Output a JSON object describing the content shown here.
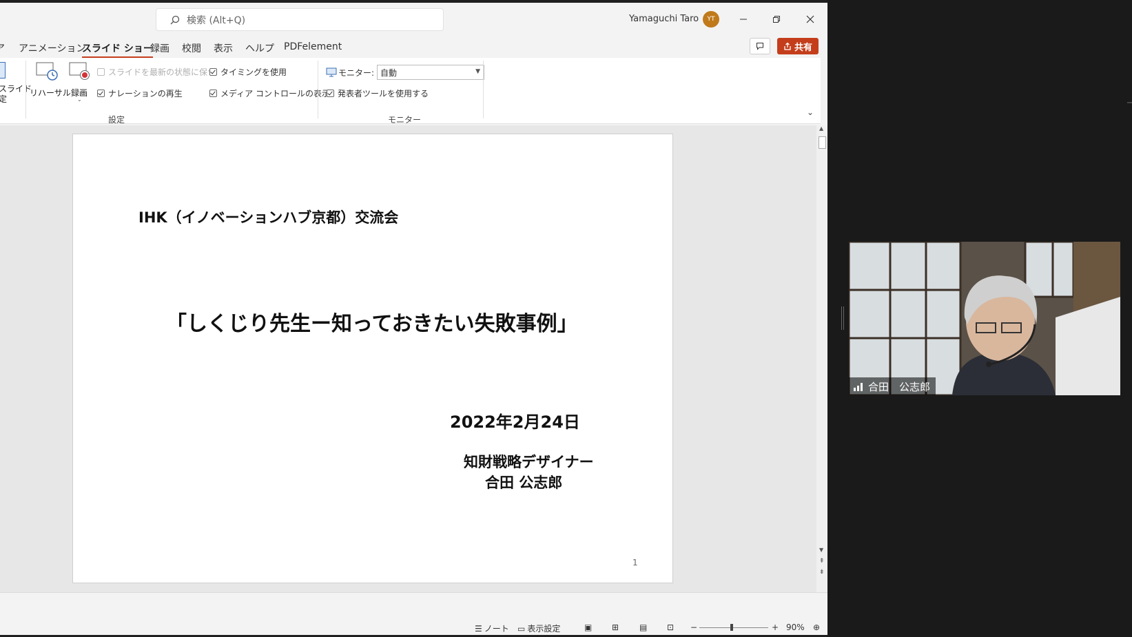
{
  "titlebar": {
    "search_placeholder": "検索 (Alt+Q)",
    "user_name": "Yamaguchi Taro",
    "avatar_initials": "YT"
  },
  "tabs": [
    {
      "label": "ア"
    },
    {
      "label": "アニメーション"
    },
    {
      "label": "スライド ショー"
    },
    {
      "label": "録画"
    },
    {
      "label": "校閲"
    },
    {
      "label": "表示"
    },
    {
      "label": "ヘルプ"
    },
    {
      "label": "PDFelement"
    }
  ],
  "share_label": "共有",
  "ribbon": {
    "partial_label_1": "スライド",
    "partial_label_2": "定",
    "rehearsal": "リハーサル",
    "record": "録画",
    "keep_updated": "スライドを最新の状態に保つ",
    "use_timings": "タイミングを使用",
    "play_narration": "ナレーションの再生",
    "show_media_controls": "メディア コントロールの表示",
    "group_setup": "設定",
    "monitor_label": "モニター:",
    "monitor_value": "自動",
    "use_presenter_view": "発表者ツールを使用する",
    "group_monitor": "モニター"
  },
  "slide": {
    "heading": "IHK（イノベーションハブ京都）交流会",
    "title": "「しくじり先生ー知っておきたい失敗事例」",
    "date": "2022年2月24日",
    "role": "知財戦略デザイナー",
    "name": "合田 公志郎",
    "page_number": "1"
  },
  "statusbar": {
    "notes": "ノート",
    "display_settings": "表示設定",
    "zoom": "90%"
  },
  "video": {
    "participant_name": "合田　公志郎"
  },
  "colors": {
    "accent": "#c43e1c",
    "avatar": "#c07a1c",
    "dark_background": "#1a1a1a"
  }
}
